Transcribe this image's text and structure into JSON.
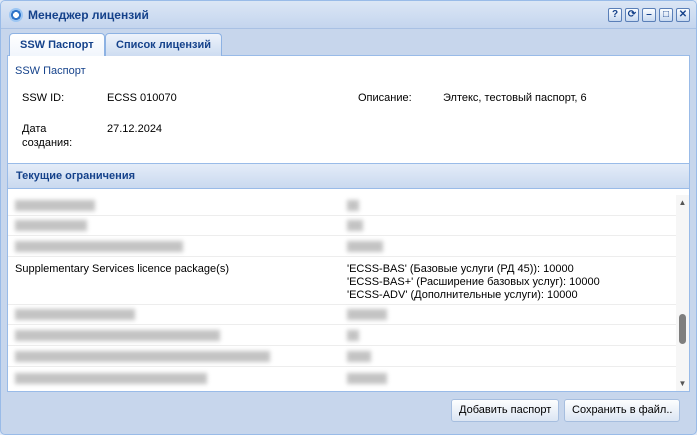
{
  "window": {
    "title": "Менеджер лицензий"
  },
  "tools": {
    "help": "?",
    "refresh": "⟳",
    "minimize": "–",
    "maximize": "□",
    "close": "✕"
  },
  "tabs": [
    {
      "label": "SSW Паспорт",
      "active": true
    },
    {
      "label": "Список лицензий",
      "active": false
    }
  ],
  "passport": {
    "heading": "SSW Паспорт",
    "ssw_id_label": "SSW ID:",
    "ssw_id_value": "ECSS 010070",
    "description_label": "Описание:",
    "description_value": "Элтекс, тестовый паспорт, 6",
    "created_label_1": "Дата",
    "created_label_2": "создания:",
    "created_value": "27.12.2024"
  },
  "limits": {
    "header": "Текущие ограничения",
    "featured_row": {
      "name": "Supplementary Services licence package(s)",
      "values": [
        "'ECSS-BAS' (Базовые услуги (РД 45)): 10000",
        "'ECSS-BAS+' (Расширение базовых услуг): 10000",
        "'ECSS-ADV' (Дополнительные услуги): 10000"
      ]
    }
  },
  "buttons": {
    "add_passport": "Добавить паспорт",
    "save_to_file": "Сохранить в файл.."
  },
  "colors": {
    "accent": "#15428b",
    "border": "#99bbe8",
    "window_bg": "#c7d6ec"
  }
}
